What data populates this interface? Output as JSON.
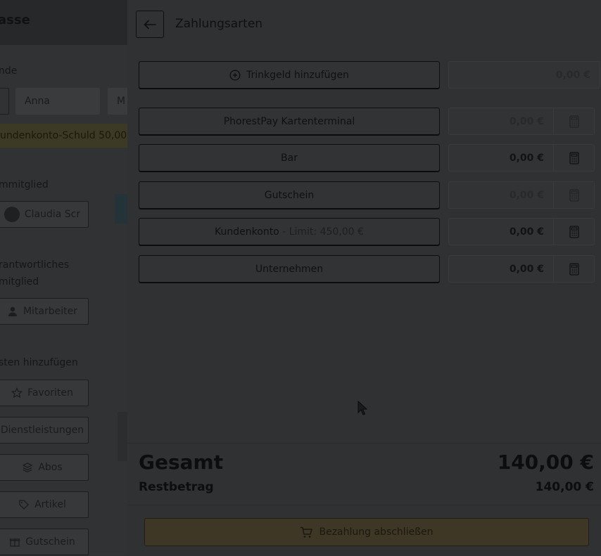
{
  "background": {
    "title": "asse",
    "customer_label": "nde",
    "customer_first_name": "Anna",
    "customer_last_initial": "M",
    "account_debt_text": "undenkonto-Schuld 50,00",
    "staff_label": "mmitglied",
    "staff_name": "Claudia Scr",
    "responsible_label_1": "rantwortliches",
    "responsible_label_2": "mitglied",
    "responsible_button": "Mitarbeiter",
    "add_items_label": "sten hinzufügen",
    "nav": [
      "Favoriten",
      "Dienstleistungen",
      "Abos",
      "Artikel",
      "Gutschein"
    ]
  },
  "panel": {
    "title": "Zahlungsarten",
    "tip": {
      "label": "Trinkgeld hinzufügen",
      "amount": "0,00 €"
    },
    "methods": [
      {
        "label": "PhorestPay Kartenterminal",
        "amount": "0,00 €"
      },
      {
        "label": "Bar",
        "amount": "0,00 €"
      },
      {
        "label": "Gutschein",
        "amount": "0,00 €"
      },
      {
        "label": "Kundenkonto",
        "suffix": " - Limit: 450,00 €",
        "amount": "0,00 €"
      },
      {
        "label": "Unternehmen",
        "amount": "0,00 €"
      }
    ],
    "totals": {
      "total_label": "Gesamt",
      "total_value": "140,00 €",
      "rest_label": "Restbetrag",
      "rest_value": "140,00 €"
    },
    "pay_button": "Bezahlung abschließen"
  },
  "icons": {
    "back": "arrow-left-icon",
    "tip": "plus-circle-icon",
    "calc": "calculator-icon",
    "cart": "cart-icon"
  }
}
